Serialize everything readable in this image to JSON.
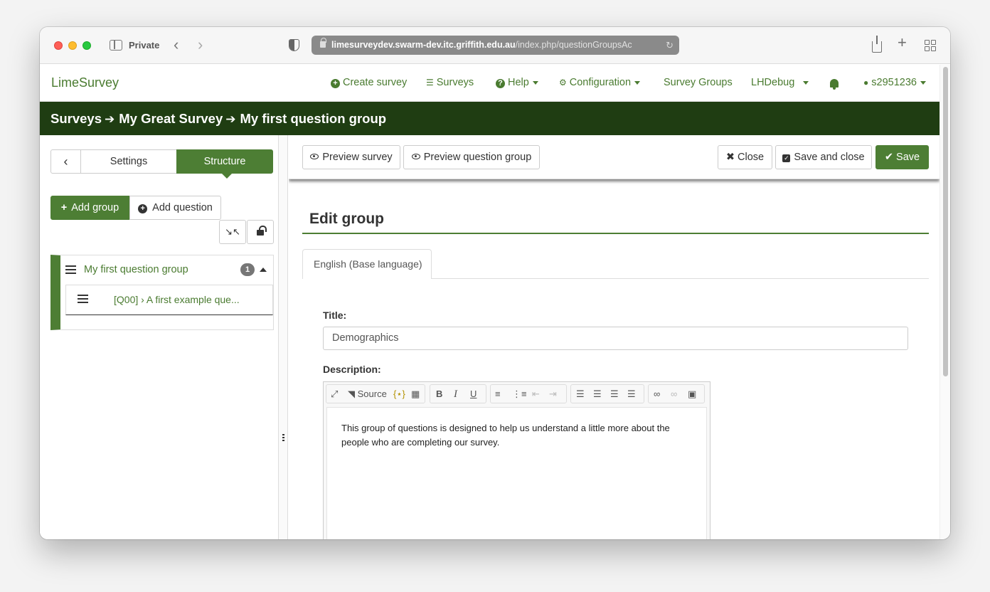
{
  "browser": {
    "private_label": "Private",
    "url_host": "limesurveydev.swarm-dev.itc.griffith.edu.au",
    "url_path": "/index.php/questionGroupsAc"
  },
  "navbar": {
    "brand": "LimeSurvey",
    "create_survey": "Create survey",
    "surveys": "Surveys",
    "help": "Help",
    "configuration": "Configuration",
    "survey_groups": "Survey Groups",
    "debug": "LHDebug",
    "user": "s2951236"
  },
  "breadcrumb": {
    "item1": "Surveys",
    "item2": "My Great Survey",
    "item3": "My first question group"
  },
  "sidebar": {
    "tab_settings": "Settings",
    "tab_structure": "Structure",
    "add_group": "Add group",
    "add_question": "Add question",
    "group_title": "My first question group",
    "group_count": "1",
    "question_label": "[Q00] › A first example que..."
  },
  "toolbar": {
    "preview_survey": "Preview survey",
    "preview_group": "Preview question group",
    "close": "Close",
    "save_and_close": "Save and close",
    "save": "Save"
  },
  "form": {
    "heading": "Edit group",
    "language_tab": "English (Base language)",
    "title_label": "Title:",
    "title_value": "Demographics",
    "description_label": "Description:",
    "source_label": "Source",
    "description_line1": "This group of questions is designed to help us understand a little more about the",
    "description_line2": "people who are completing our survey."
  }
}
